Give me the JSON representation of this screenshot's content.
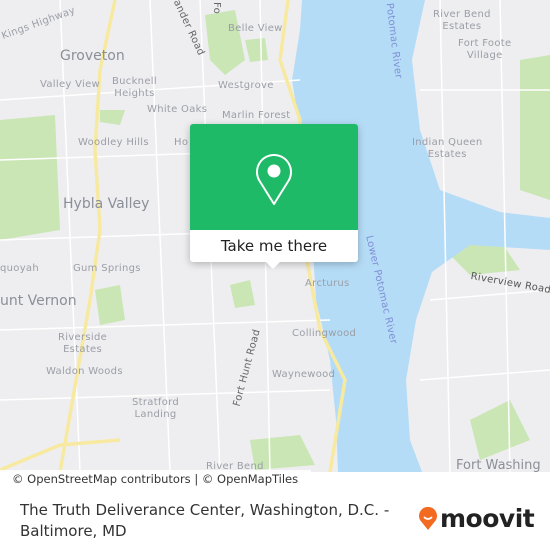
{
  "map": {
    "labels": {
      "kings_highway": "Kings Highway",
      "groveton": "Groveton",
      "valley_view": "Valley View",
      "bucknell_heights": "Bucknell\nHeights",
      "belle_view": "Belle View",
      "westgrove": "Westgrove",
      "white_oaks": "White Oaks",
      "marlin_forest": "Marlin Forest",
      "woodley_hills": "Woodley Hills",
      "ho": "Ho",
      "hybla_valley": "Hybla Valley",
      "gum_springs": "Gum Springs",
      "sequoyah": "quoyah",
      "mount_vernon": "unt Vernon",
      "riverside_estates": "Riverside\nEstates",
      "waldon_woods": "Waldon Woods",
      "stratford_landing": "Stratford\nLanding",
      "river_bend": "River Bend",
      "waynewood": "Waynewood",
      "collingwood": "Collingwood",
      "arcturus": "Arcturus",
      "fort_hunt_road": "Fort Hunt Road",
      "ander_road": "ander Road",
      "fo": "Fo",
      "potomac_river": "Potomac River",
      "lower_potomac_river": "Lower Potomac River",
      "river_bend_estates": "River Bend\nEstates",
      "fort_foote_village": "Fort Foote\nVillage",
      "indian_queen_estates": "Indian Queen\nEstates",
      "riverview_road": "Riverview Road",
      "fort_washington": "Fort Washing"
    },
    "colors": {
      "land": "#eeeef0",
      "water": "#b5dcf7",
      "park": "#c9e6b4",
      "highway": "#f7e9a0"
    }
  },
  "popup": {
    "button_label": "Take me there",
    "icon": "map-pin-icon",
    "color": "#1fba68"
  },
  "attribution": "© OpenStreetMap contributors | © OpenMapTiles",
  "footer": {
    "title": "The Truth Deliverance Center, Washington, D.C. - Baltimore, MD",
    "logo": "moovit",
    "logo_color": "#f26b21"
  }
}
